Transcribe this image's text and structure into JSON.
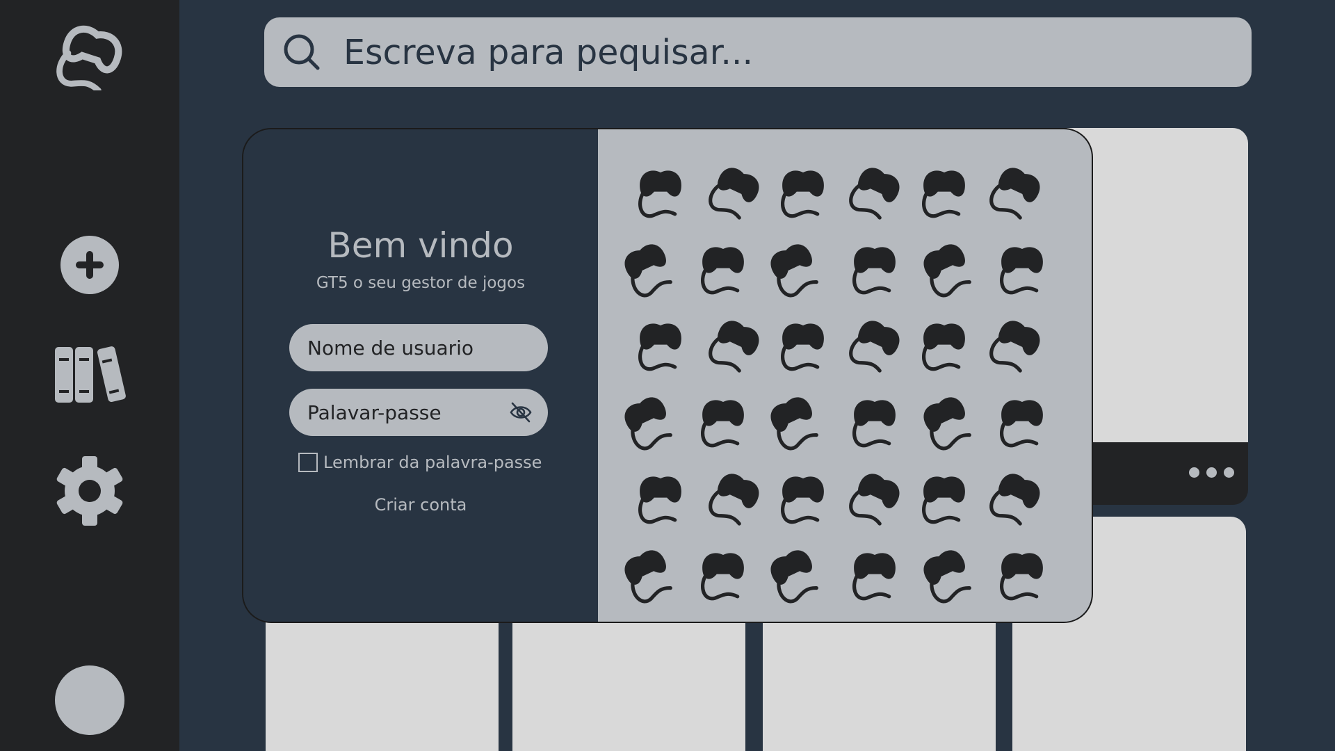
{
  "app": {
    "accent_color": "#b6babf",
    "background_color": "#283442",
    "sidebar_color": "#222325"
  },
  "sidebar": {
    "items": [
      {
        "icon": "gamepad-logo-icon"
      },
      {
        "icon": "plus-icon"
      },
      {
        "icon": "library-icon"
      },
      {
        "icon": "gear-icon"
      },
      {
        "icon": "avatar"
      }
    ]
  },
  "search": {
    "placeholder": "Escreva para pequisar..."
  },
  "login": {
    "title": "Bem vindo",
    "subtitle": "GT5 o seu gestor de jogos",
    "username_placeholder": "Nome de usuario",
    "password_placeholder": "Palavar-passe",
    "remember_label": "Lembrar da palavra-passe",
    "create_account_label": "Criar conta",
    "pattern_icon": "gamepad-icon"
  }
}
